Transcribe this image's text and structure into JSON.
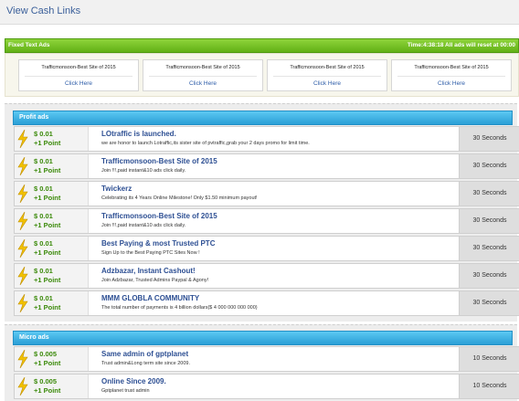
{
  "header": {
    "title": "View Cash Links"
  },
  "fixed_ads": {
    "label": "Fixed Text Ads",
    "status": "Time:4:38:18 All ads will reset at 00:00",
    "items": [
      {
        "title": "Trafficmonsoon-Best Site of 2015",
        "link": "Click Here"
      },
      {
        "title": "Trafficmonsoon-Best Site of 2015",
        "link": "Click Here"
      },
      {
        "title": "Trafficmonsoon-Best Site of 2015",
        "link": "Click Here"
      },
      {
        "title": "Trafficmonsoon-Best Site of 2015",
        "link": "Click Here"
      }
    ]
  },
  "profit_ads": {
    "label": "Profit ads",
    "rows": [
      {
        "price": "$ 0.01",
        "points": "+1 Point",
        "title": "LOtraffic is launched.",
        "desc": "we are honor to launch Lotraffic,its sister site of pvtraffic,grab your 2 days promo for limit time.",
        "duration": "30 Seconds"
      },
      {
        "price": "$ 0.01",
        "points": "+1 Point",
        "title": "Trafficmonsoon-Best Site of 2015",
        "desc": "Join !!!,paid instant&10 ads click daily.",
        "duration": "30 Seconds"
      },
      {
        "price": "$ 0.01",
        "points": "+1 Point",
        "title": "Twickerz",
        "desc": "Celebrating its 4 Years Online Milestone! Only $1.50 minimum payout!",
        "duration": "30 Seconds"
      },
      {
        "price": "$ 0.01",
        "points": "+1 Point",
        "title": "Trafficmonsoon-Best Site of 2015",
        "desc": "Join !!!,paid instant&10 ads click daily.",
        "duration": "30 Seconds"
      },
      {
        "price": "$ 0.01",
        "points": "+1 Point",
        "title": "Best Paying & most Trusted PTC",
        "desc": "Sign Up to the Best Paying PTC Sites Now !",
        "duration": "30 Seconds"
      },
      {
        "price": "$ 0.01",
        "points": "+1 Point",
        "title": "Adzbazar, Instant Cashout!",
        "desc": "Join Adzbazar, Trusted Admins Paypal & Agony!",
        "duration": "30 Seconds"
      },
      {
        "price": "$ 0.01",
        "points": "+1 Point",
        "title": "MMM GLOBLA COMMUNITY",
        "desc": "The total number of payments is 4 billion dollars($ 4 000 000 000 000)",
        "duration": "30 Seconds"
      }
    ]
  },
  "micro_ads": {
    "label": "Micro ads",
    "rows": [
      {
        "price": "$ 0.005",
        "points": "+1 Point",
        "title": "Same admin of gptplanet",
        "desc": "Trust admin&Long term site since 2009.",
        "duration": "10 Seconds"
      },
      {
        "price": "$ 0.005",
        "points": "+1 Point",
        "title": "Online Since 2009.",
        "desc": "Gptplanet trust admin",
        "duration": "10 Seconds"
      }
    ]
  }
}
